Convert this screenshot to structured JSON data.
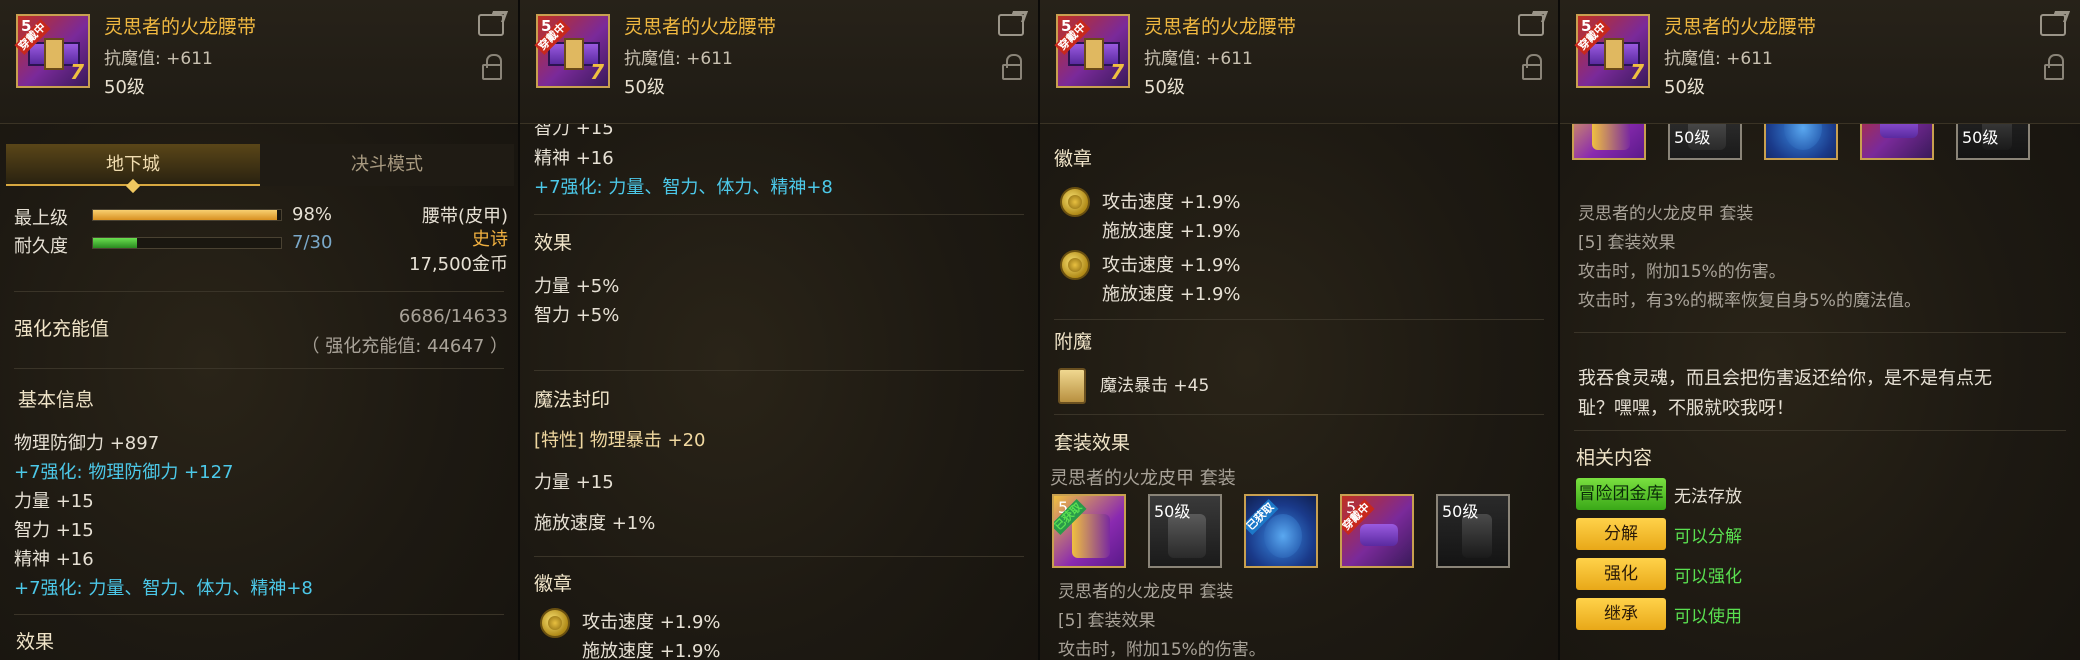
{
  "item": {
    "name": "灵思者的火龙腰带",
    "stat": "抗魔值: +611",
    "level": "50级",
    "plus": "5",
    "seven": "7",
    "equipped_badge": "穿戴中"
  },
  "panel1": {
    "tabs": [
      "地下城",
      "决斗模式"
    ],
    "grade_label": "最上级",
    "grade_pct": "98%",
    "grade_value": 0.98,
    "durability_label": "耐久度",
    "durability_value": "7/30",
    "durability_fraction": 0.233,
    "type": "腰带(皮甲)",
    "rarity": "史诗",
    "price": "17,500金币",
    "charge_label": "强化充能值",
    "charge_value": "6686/14633",
    "charge_total": "（ 强化充能值: 44647 ）",
    "basic_title": "基本信息",
    "lines": [
      {
        "text": "物理防御力 +897",
        "style": "white"
      },
      {
        "text": "+7强化: 物理防御力 +127",
        "style": "cyan"
      },
      {
        "text": "力量 +15",
        "style": "white"
      },
      {
        "text": "智力 +15",
        "style": "white"
      },
      {
        "text": "精神 +16",
        "style": "white"
      },
      {
        "text": "+7强化: 力量、智力、体力、精神+8",
        "style": "cyan"
      }
    ],
    "effect_title": "效果"
  },
  "panel2": {
    "partial_top": "智力 +15",
    "spirit": "精神 +16",
    "enhance": "+7强化: 力量、智力、体力、精神+8",
    "effect_title": "效果",
    "effects": [
      "力量 +5%",
      "智力 +5%"
    ],
    "seal_title": "魔法封印",
    "seal_special": "[特性] 物理暴击 +20",
    "seal_lines": [
      "力量 +15",
      "施放速度 +1%"
    ],
    "emblem_title": "徽章",
    "emblem_line1": "攻击速度 +1.9%",
    "emblem_line2": "施放速度 +1.9%"
  },
  "panel3": {
    "emblem_title": "徽章",
    "emblems": [
      {
        "l1": "攻击速度 +1.9%",
        "l2": "施放速度 +1.9%"
      },
      {
        "l1": "攻击速度 +1.9%",
        "l2": "施放速度 +1.9%"
      }
    ],
    "enchant_title": "附魔",
    "enchant_line": "魔法暴击 +45",
    "set_title": "套装效果",
    "set_name": "灵思者的火龙皮甲 套装",
    "slots": [
      {
        "badge": "已获取",
        "lv": "5"
      },
      {
        "lv": "50级"
      },
      {
        "badge": "已获取",
        "lv": ""
      },
      {
        "badge": "穿戴中",
        "lv": "5"
      },
      {
        "lv": "50级"
      }
    ],
    "set_name2": "灵思者的火龙皮甲 套装",
    "set_count": "[5] 套装效果",
    "set_effect1": "攻击时，附加15%的伤害。"
  },
  "panel4": {
    "slots": [
      {
        "lv": ""
      },
      {
        "lv": "50级"
      },
      {
        "lv": ""
      },
      {
        "lv": ""
      },
      {
        "lv": "50级"
      }
    ],
    "set_name": "灵思者的火龙皮甲 套装",
    "set_count": "[5] 套装效果",
    "set_effect1": "攻击时，附加15%的伤害。",
    "set_effect2": "攻击时，有3%的概率恢复自身5%的魔法值。",
    "flavor1": "我吞食灵魂，而且会把伤害返还给你，是不是有点无",
    "flavor2": "耻？嘿嘿，不服就咬我呀！",
    "related_title": "相关内容",
    "actions": [
      {
        "btn": "冒险团金库",
        "status": "无法存放"
      },
      {
        "btn": "分解",
        "status": "可以分解"
      },
      {
        "btn": "强化",
        "status": "可以强化"
      },
      {
        "btn": "继承",
        "status": "可以使用"
      }
    ]
  },
  "colors": {
    "name_gold": "#f0b840",
    "enhance_cyan": "#4cc8e8",
    "grade_bar": "#f0b040",
    "durability_bar": "#3ab030",
    "status_green": "#5ae050"
  }
}
